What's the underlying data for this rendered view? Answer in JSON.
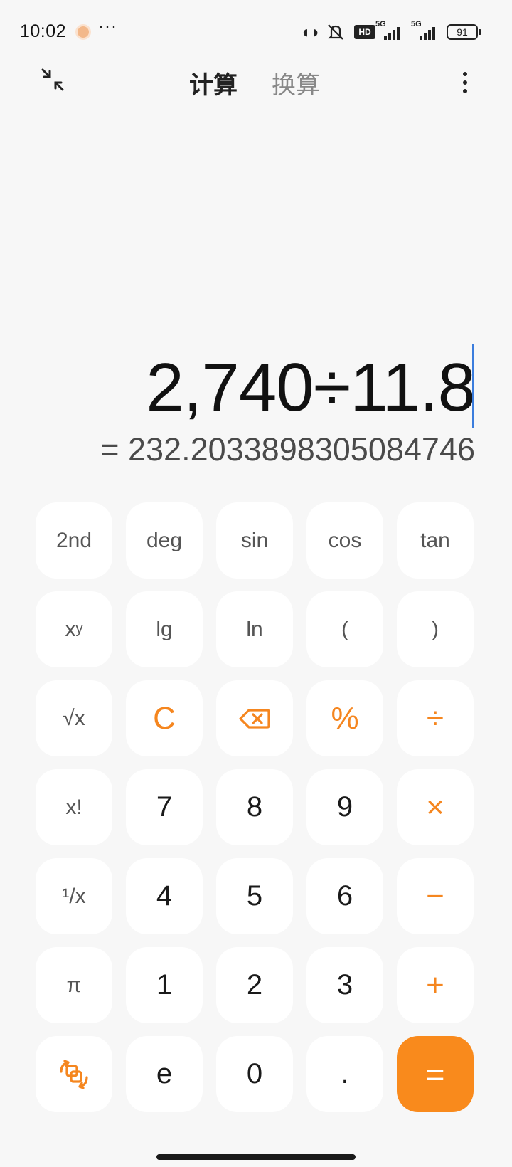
{
  "status_bar": {
    "time": "10:02",
    "more": "···",
    "hd_label": "HD",
    "network1": "5G",
    "network2": "5G",
    "battery": "91"
  },
  "header": {
    "tabs": [
      {
        "label": "计算",
        "active": true
      },
      {
        "label": "换算",
        "active": false
      }
    ]
  },
  "display": {
    "expression": "2,740÷11.8",
    "result": "= 232.2033898305084746"
  },
  "keypad": {
    "rows": [
      [
        {
          "name": "second-function-key",
          "label": "2nd",
          "kind": "fn"
        },
        {
          "name": "degree-mode-key",
          "label": "deg",
          "kind": "fn"
        },
        {
          "name": "sin-key",
          "label": "sin",
          "kind": "fn"
        },
        {
          "name": "cos-key",
          "label": "cos",
          "kind": "fn"
        },
        {
          "name": "tan-key",
          "label": "tan",
          "kind": "fn"
        }
      ],
      [
        {
          "name": "power-key",
          "label": "x",
          "sup": "y",
          "kind": "fn"
        },
        {
          "name": "log-key",
          "label": "lg",
          "kind": "fn"
        },
        {
          "name": "ln-key",
          "label": "ln",
          "kind": "fn"
        },
        {
          "name": "open-paren-key",
          "label": "(",
          "kind": "fn"
        },
        {
          "name": "close-paren-key",
          "label": ")",
          "kind": "fn"
        }
      ],
      [
        {
          "name": "sqrt-key",
          "label": "√x",
          "kind": "fn"
        },
        {
          "name": "clear-key",
          "label": "C",
          "kind": "op"
        },
        {
          "name": "backspace-key",
          "label": "",
          "kind": "op",
          "icon": "backspace-icon"
        },
        {
          "name": "percent-key",
          "label": "%",
          "kind": "op"
        },
        {
          "name": "divide-key",
          "label": "÷",
          "kind": "op"
        }
      ],
      [
        {
          "name": "factorial-key",
          "label": "x!",
          "kind": "fn"
        },
        {
          "name": "digit-7-key",
          "label": "7",
          "kind": "num"
        },
        {
          "name": "digit-8-key",
          "label": "8",
          "kind": "num"
        },
        {
          "name": "digit-9-key",
          "label": "9",
          "kind": "num"
        },
        {
          "name": "multiply-key",
          "label": "×",
          "kind": "op"
        }
      ],
      [
        {
          "name": "reciprocal-key",
          "label": "¹/x",
          "kind": "fn"
        },
        {
          "name": "digit-4-key",
          "label": "4",
          "kind": "num"
        },
        {
          "name": "digit-5-key",
          "label": "5",
          "kind": "num"
        },
        {
          "name": "digit-6-key",
          "label": "6",
          "kind": "num"
        },
        {
          "name": "subtract-key",
          "label": "−",
          "kind": "op"
        }
      ],
      [
        {
          "name": "pi-key",
          "label": "π",
          "kind": "fn"
        },
        {
          "name": "digit-1-key",
          "label": "1",
          "kind": "num"
        },
        {
          "name": "digit-2-key",
          "label": "2",
          "kind": "num"
        },
        {
          "name": "digit-3-key",
          "label": "3",
          "kind": "num"
        },
        {
          "name": "add-key",
          "label": "+",
          "kind": "op"
        }
      ],
      [
        {
          "name": "switch-mode-key",
          "label": "",
          "kind": "op",
          "icon": "switch-icon"
        },
        {
          "name": "e-key",
          "label": "e",
          "kind": "num"
        },
        {
          "name": "digit-0-key",
          "label": "0",
          "kind": "num"
        },
        {
          "name": "decimal-key",
          "label": ".",
          "kind": "num"
        },
        {
          "name": "equals-key",
          "label": "=",
          "kind": "eq"
        }
      ]
    ]
  },
  "colors": {
    "accent": "#f98a1c",
    "background": "#f7f7f7",
    "key_background": "#ffffff",
    "cursor": "#3b7ddd"
  }
}
